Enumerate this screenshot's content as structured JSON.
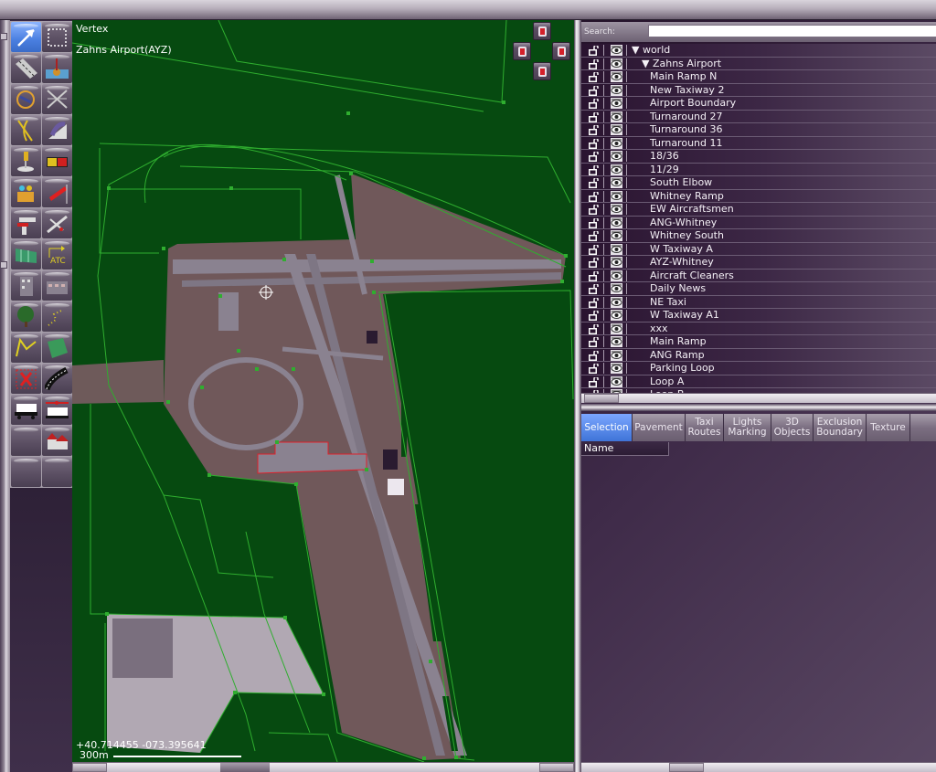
{
  "map": {
    "mode_label": "Vertex",
    "airport_label": "Zahns Airport(AYZ)",
    "coordinates": "+40.714455 -073.395641",
    "scale_label": "300m",
    "colors": {
      "background": "#064a10",
      "pavement": "#6e5a5a",
      "overlay_line": "#2fae2f",
      "taxiway": "#8a8290"
    }
  },
  "tools": [
    {
      "name": "vertex-tool",
      "icon": "arrow-pointer-icon",
      "active": true
    },
    {
      "name": "marquee-tool",
      "icon": "dashed-rectangle-icon"
    },
    {
      "name": "runway-tool",
      "icon": "runway-icon"
    },
    {
      "name": "sealane-tool",
      "icon": "sealane-buoy-icon"
    },
    {
      "name": "helipad-tool",
      "icon": "helipad-icon"
    },
    {
      "name": "taxiway-tool",
      "icon": "taxiway-pavement-icon"
    },
    {
      "name": "taxi-line-tool",
      "icon": "taxi-line-icon"
    },
    {
      "name": "hole-tool",
      "icon": "hole-icon"
    },
    {
      "name": "light-fixture-tool",
      "icon": "light-fixture-icon"
    },
    {
      "name": "taxi-sign-tool",
      "icon": "taxi-sign-icon"
    },
    {
      "name": "beacon-tool",
      "icon": "beacon-icon"
    },
    {
      "name": "windsock-tool",
      "icon": "windsock-icon"
    },
    {
      "name": "tower-viewpoint-tool",
      "icon": "tower-viewpoint-icon"
    },
    {
      "name": "ramp-start-tool",
      "icon": "airplane-icon"
    },
    {
      "name": "facade-tool",
      "icon": "facade-fence-icon"
    },
    {
      "name": "atc-frequency-tool",
      "icon": "atc-icon"
    },
    {
      "name": "building-tool",
      "icon": "building-icon"
    },
    {
      "name": "building2-tool",
      "icon": "building-wide-icon"
    },
    {
      "name": "forest-tool",
      "icon": "tree-icon"
    },
    {
      "name": "line-tool",
      "icon": "dotted-line-icon"
    },
    {
      "name": "string-tool",
      "icon": "polyline-icon"
    },
    {
      "name": "polygon-tool",
      "icon": "polygon-icon"
    },
    {
      "name": "exclusion-tool",
      "icon": "exclusion-x-icon"
    },
    {
      "name": "road-tool",
      "icon": "road-icon"
    },
    {
      "name": "truck-parking-tool",
      "icon": "truck-icon"
    },
    {
      "name": "truck-destination-tool",
      "icon": "truck-destination-icon"
    },
    {
      "name": "empty-tool-1",
      "icon": "blank-icon"
    },
    {
      "name": "autogen-tool",
      "icon": "houses-icon"
    },
    {
      "name": "empty-tool-2",
      "icon": "blank-icon"
    },
    {
      "name": "empty-tool-3",
      "icon": "blank-icon"
    }
  ],
  "right_panel": {
    "search_label": "Search:",
    "search_value": "",
    "tree": [
      {
        "label": "▼ world",
        "level": 0
      },
      {
        "label": "▼ Zahns Airport",
        "level": 1
      },
      {
        "label": "Main Ramp N",
        "level": 2
      },
      {
        "label": "New Taxiway 2",
        "level": 2
      },
      {
        "label": "Airport Boundary",
        "level": 2
      },
      {
        "label": "Turnaround 27",
        "level": 2
      },
      {
        "label": "Turnaround 36",
        "level": 2
      },
      {
        "label": "Turnaround 11",
        "level": 2
      },
      {
        "label": "18/36",
        "level": 2
      },
      {
        "label": "11/29",
        "level": 2
      },
      {
        "label": "South Elbow",
        "level": 2
      },
      {
        "label": "Whitney Ramp",
        "level": 2
      },
      {
        "label": "EW Aircraftsmen",
        "level": 2
      },
      {
        "label": "ANG-Whitney",
        "level": 2
      },
      {
        "label": "Whitney South",
        "level": 2
      },
      {
        "label": "W Taxiway A",
        "level": 2
      },
      {
        "label": "AYZ-Whitney",
        "level": 2
      },
      {
        "label": "Aircraft Cleaners",
        "level": 2
      },
      {
        "label": "Daily News",
        "level": 2
      },
      {
        "label": "NE Taxi",
        "level": 2
      },
      {
        "label": "W Taxiway A1",
        "level": 2
      },
      {
        "label": "xxx",
        "level": 2
      },
      {
        "label": "Main Ramp",
        "level": 2
      },
      {
        "label": "ANG Ramp",
        "level": 2
      },
      {
        "label": "Parking Loop",
        "level": 2
      },
      {
        "label": "Loop A",
        "level": 2
      },
      {
        "label": "Loop B",
        "level": 2
      }
    ],
    "tabs": [
      {
        "label": "Selection",
        "active": true
      },
      {
        "label": "Pavement"
      },
      {
        "label": "Taxi Routes"
      },
      {
        "label": "Lights Marking"
      },
      {
        "label": "3D Objects"
      },
      {
        "label": "Exclusion Boundary"
      },
      {
        "label": "Texture"
      }
    ],
    "property_column_header": "Name"
  }
}
